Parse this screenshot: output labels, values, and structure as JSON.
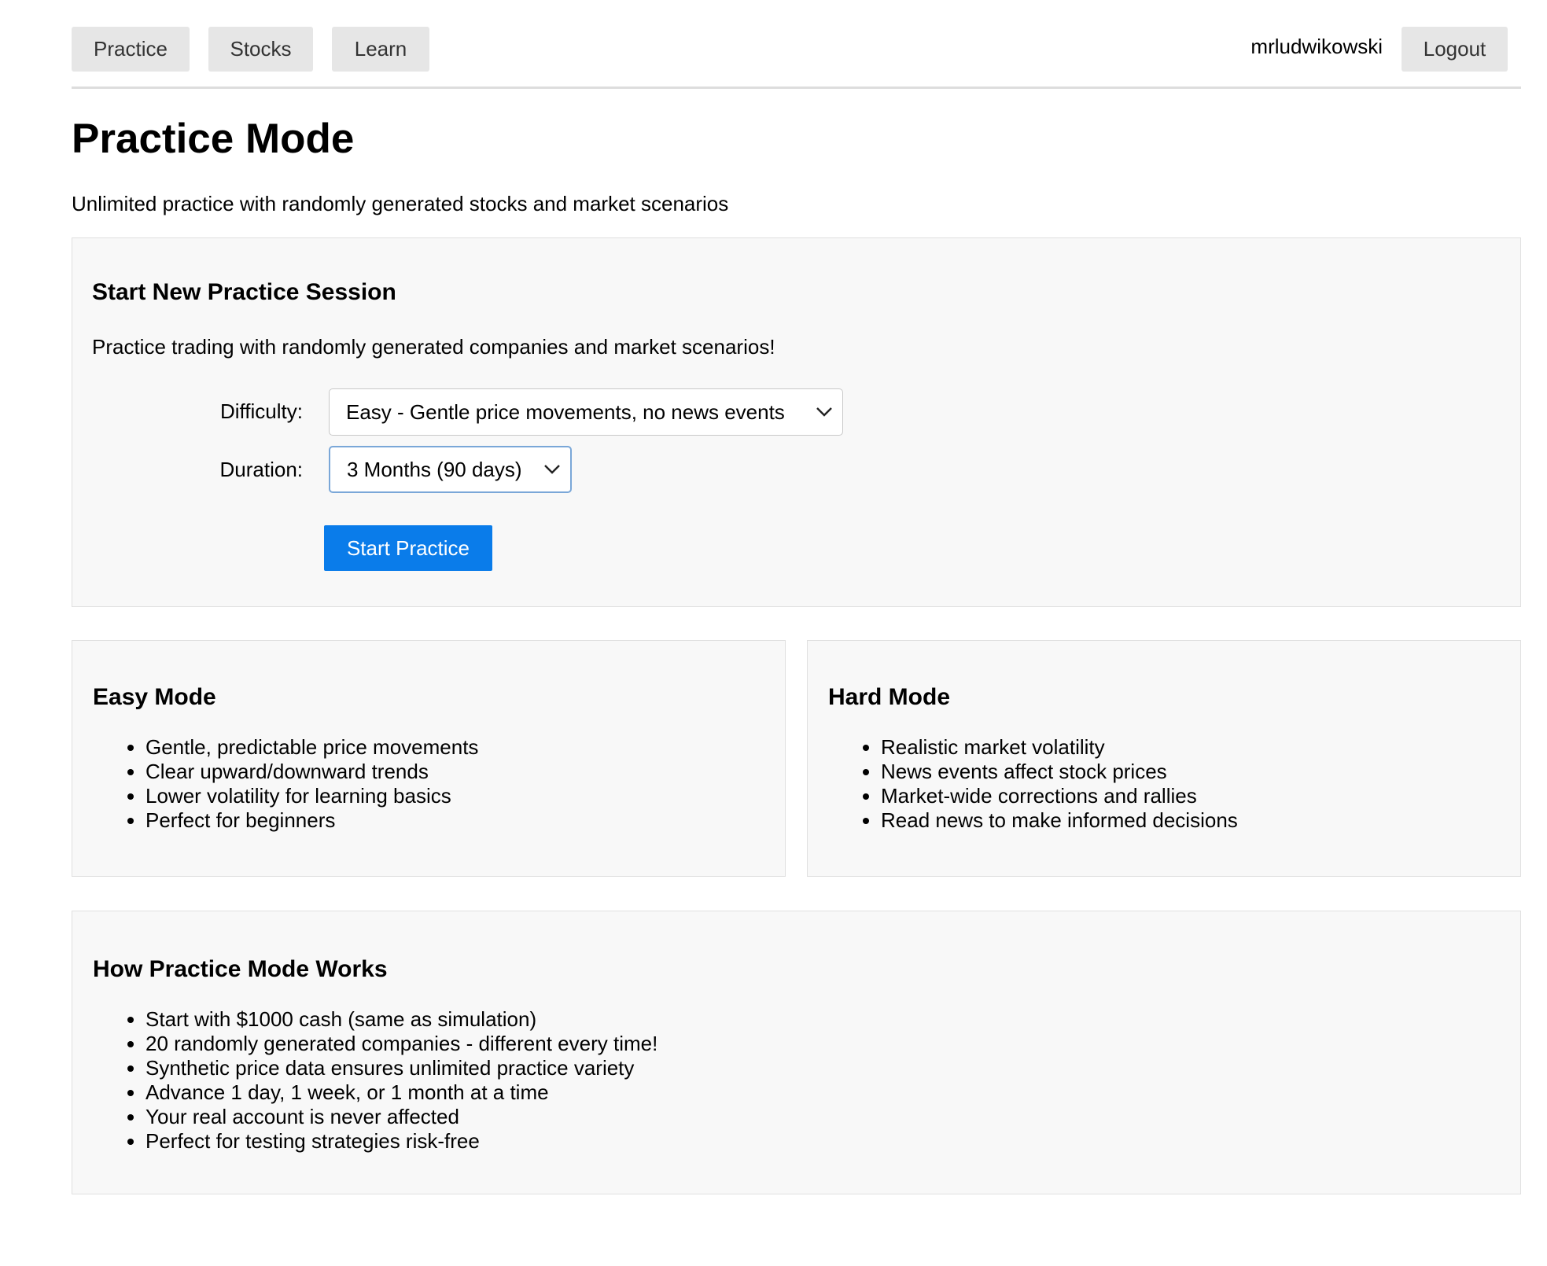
{
  "nav": {
    "practice_label": "Practice",
    "stocks_label": "Stocks",
    "learn_label": "Learn",
    "username": "mrludwikowski",
    "logout_label": "Logout"
  },
  "page": {
    "title": "Practice Mode",
    "subtitle": "Unlimited practice with randomly generated stocks and market scenarios"
  },
  "session": {
    "heading": "Start New Practice Session",
    "description": "Practice trading with randomly generated companies and market scenarios!",
    "difficulty_label": "Difficulty:",
    "difficulty_value": "Easy - Gentle price movements, no news events",
    "duration_label": "Duration:",
    "duration_value": "3 Months (90 days)",
    "start_label": "Start Practice"
  },
  "easy_mode": {
    "heading": "Easy Mode",
    "items": [
      "Gentle, predictable price movements",
      "Clear upward/downward trends",
      "Lower volatility for learning basics",
      "Perfect for beginners"
    ]
  },
  "hard_mode": {
    "heading": "Hard Mode",
    "items": [
      "Realistic market volatility",
      "News events affect stock prices",
      "Market-wide corrections and rallies",
      "Read news to make informed decisions"
    ]
  },
  "how_it_works": {
    "heading": "How Practice Mode Works",
    "items": [
      "Start with $1000 cash (same as simulation)",
      "20 randomly generated companies - different every time!",
      "Synthetic price data ensures unlimited practice variety",
      "Advance 1 day, 1 week, or 1 month at a time",
      "Your real account is never affected",
      "Perfect for testing strategies risk-free"
    ]
  },
  "colors": {
    "primary_button": "#0a7cea",
    "nav_button_bg": "#e6e6e6",
    "panel_bg": "#f8f8f8"
  },
  "icons": {
    "select_arrow": "chevron-down-icon"
  }
}
